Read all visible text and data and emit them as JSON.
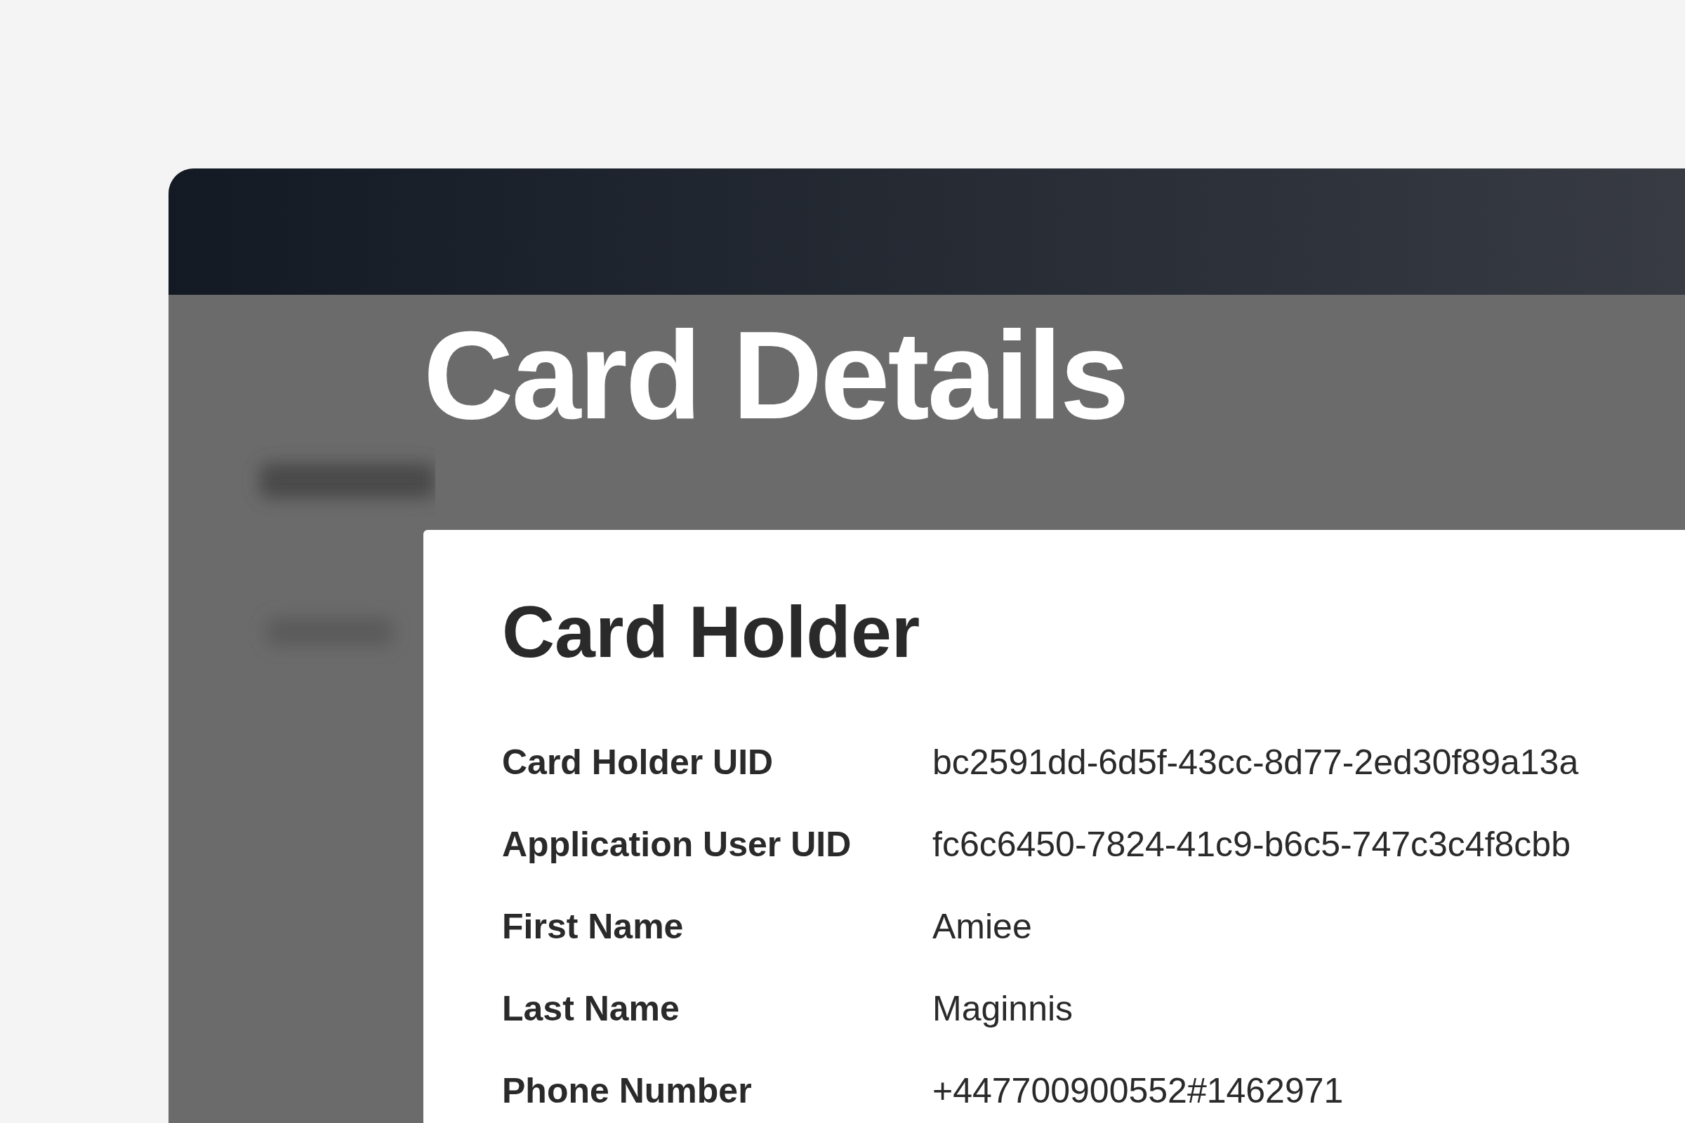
{
  "page": {
    "title": "Card Details"
  },
  "card": {
    "title": "Card Holder",
    "fields": [
      {
        "label": "Card Holder UID",
        "value": "bc2591dd-6d5f-43cc-8d77-2ed30f89a13a"
      },
      {
        "label": "Application User UID",
        "value": "fc6c6450-7824-41c9-b6c5-747c3c4f8cbb"
      },
      {
        "label": "First Name",
        "value": "Amiee"
      },
      {
        "label": "Last Name",
        "value": "Maginnis"
      },
      {
        "label": "Phone Number",
        "value": "+447700900552#1462971"
      }
    ]
  }
}
